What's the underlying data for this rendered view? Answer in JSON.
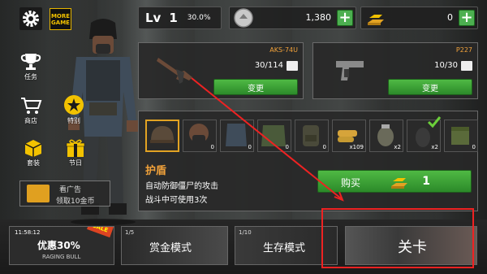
{
  "left_menu": {
    "more_game": "MORE GAME",
    "task_label": "任务",
    "shop_label": "商店",
    "special_label": "特别",
    "package_label": "套装",
    "gift_label": "节日"
  },
  "top_bar": {
    "level_prefix": "Lv",
    "level": "1",
    "level_percent": "30.0%",
    "coins": "1,380",
    "gold": "0"
  },
  "weapons": {
    "primary": {
      "name": "AKS-74U",
      "ammo": "30/114",
      "change_label": "变更"
    },
    "secondary": {
      "name": "P227",
      "ammo": "10/30",
      "change_label": "变更"
    }
  },
  "items": [
    {
      "icon": "helmet-icon",
      "count": ""
    },
    {
      "icon": "gas-mask-icon",
      "count": "0"
    },
    {
      "icon": "vest-icon",
      "count": "0"
    },
    {
      "icon": "jacket-icon",
      "count": "0"
    },
    {
      "icon": "backpack-icon",
      "count": "0"
    },
    {
      "icon": "ammo-icon",
      "count": "x109"
    },
    {
      "icon": "grenade-icon",
      "count": "x2"
    },
    {
      "icon": "frag-grenade-icon",
      "count": "x2"
    },
    {
      "icon": "ammo-box-icon",
      "count": "0"
    }
  ],
  "selected_item": {
    "title": "护盾",
    "desc_line1": "自动防御僵尸的攻击",
    "desc_line2": "战斗中可使用3次",
    "buy_label": "购买",
    "price": "1"
  },
  "ad": {
    "line1": "看广告",
    "line2": "领取10金币"
  },
  "modes": {
    "sale": {
      "timer": "11:58:12",
      "label": "优惠30%",
      "subtitle": "RAGING BULL",
      "tag": "SALE"
    },
    "bounty": {
      "count": "1/5",
      "label": "赏金模式"
    },
    "survival": {
      "count": "1/10",
      "label": "生存模式"
    },
    "level": {
      "label": "关卡"
    }
  },
  "colors": {
    "accent_orange": "#f2a23a",
    "button_green": "#2c8a2a",
    "highlight_red": "#e22222"
  }
}
